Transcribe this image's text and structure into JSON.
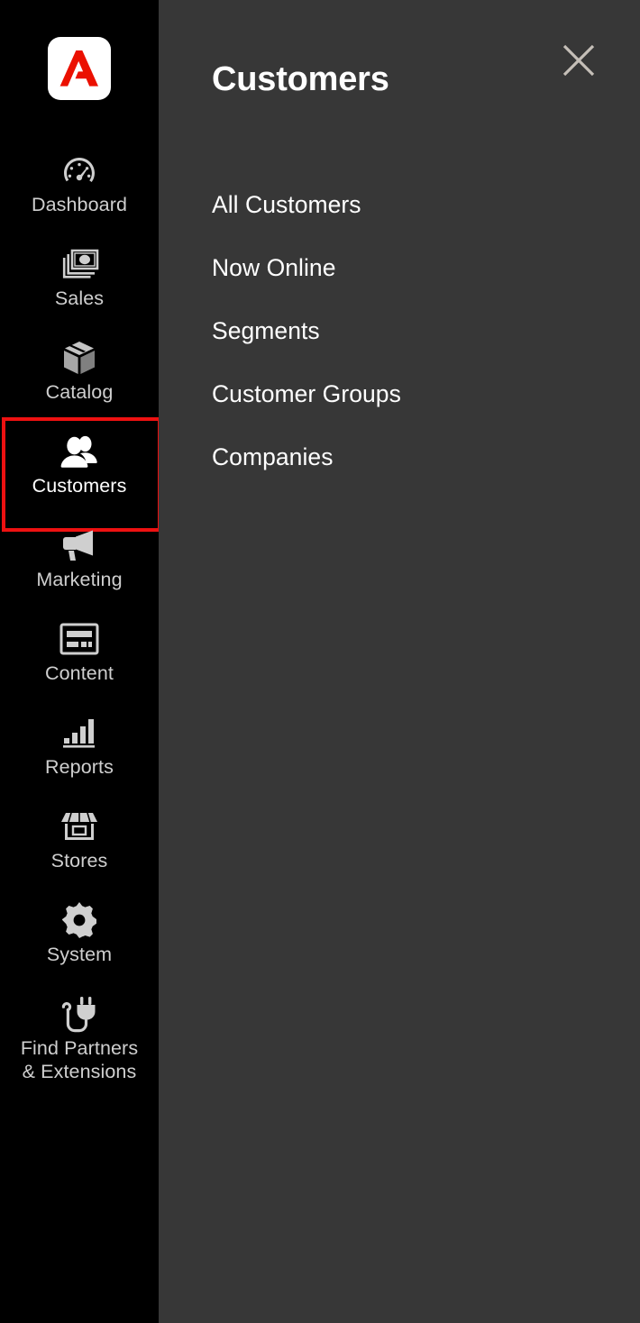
{
  "colors": {
    "sidebar_bg": "#000000",
    "panel_bg": "#373737",
    "accent_red": "#ee1111",
    "logo_red": "#eb1000",
    "nav_label": "#cfcfcf",
    "active_label": "#ffffff",
    "close_icon": "#c5bfb8"
  },
  "sidebar": {
    "logo": {
      "name": "adobe-commerce-logo",
      "alt": "Adobe"
    },
    "items": [
      {
        "id": "dashboard",
        "label": "Dashboard",
        "icon": "gauge-icon",
        "active": false
      },
      {
        "id": "sales",
        "label": "Sales",
        "icon": "banknotes-icon",
        "active": false
      },
      {
        "id": "catalog",
        "label": "Catalog",
        "icon": "box-icon",
        "active": false
      },
      {
        "id": "customers",
        "label": "Customers",
        "icon": "users-icon",
        "active": true
      },
      {
        "id": "marketing",
        "label": "Marketing",
        "icon": "megaphone-icon",
        "active": false
      },
      {
        "id": "content",
        "label": "Content",
        "icon": "page-layout-icon",
        "active": false
      },
      {
        "id": "reports",
        "label": "Reports",
        "icon": "bar-chart-icon",
        "active": false
      },
      {
        "id": "stores",
        "label": "Stores",
        "icon": "storefront-icon",
        "active": false
      },
      {
        "id": "system",
        "label": "System",
        "icon": "gear-icon",
        "active": false
      },
      {
        "id": "partners",
        "label": "Find Partners\n& Extensions",
        "icon": "plug-icon",
        "active": false
      }
    ]
  },
  "panel": {
    "title": "Customers",
    "close_label": "close-icon",
    "menu": [
      {
        "id": "all-customers",
        "label": "All Customers"
      },
      {
        "id": "now-online",
        "label": "Now Online"
      },
      {
        "id": "segments",
        "label": "Segments"
      },
      {
        "id": "customer-groups",
        "label": "Customer Groups"
      },
      {
        "id": "companies",
        "label": "Companies"
      }
    ]
  }
}
